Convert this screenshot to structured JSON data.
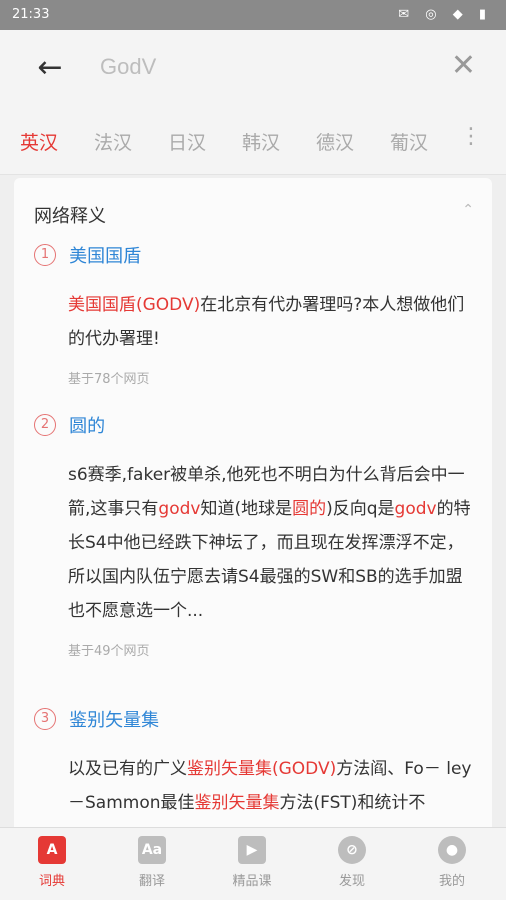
{
  "status": {
    "time": "21:33"
  },
  "search": {
    "query": "GodV"
  },
  "tabs": [
    "英汉",
    "法汉",
    "日汉",
    "韩汉",
    "德汉",
    "葡汉"
  ],
  "section": {
    "title": "网络释义"
  },
  "entries": [
    {
      "num": "1",
      "headword": "美国国盾",
      "example_parts": [
        {
          "t": "美国国盾",
          "h": true
        },
        {
          "t": "(GODV)",
          "h": true
        },
        {
          "t": "在北京有代办署理吗?本人想做他们的代办署理!",
          "h": false
        }
      ],
      "source": "基于78个网页"
    },
    {
      "num": "2",
      "headword": "圆的",
      "example_parts": [
        {
          "t": "s6赛季,faker被单杀,他死也不明白为什么背后会中一箭,这事只有",
          "h": false
        },
        {
          "t": "godv",
          "h": true
        },
        {
          "t": "知道(地球是",
          "h": false
        },
        {
          "t": "圆的",
          "h": true
        },
        {
          "t": ")反向q是",
          "h": false
        },
        {
          "t": "godv",
          "h": true
        },
        {
          "t": "的特长S4中他已经跌下神坛了，而且现在发挥漂浮不定，所以国内队伍宁愿去请S4最强的SW和SB的选手加盟也不愿意选一个...",
          "h": false
        }
      ],
      "source": "基于49个网页"
    },
    {
      "num": "3",
      "headword": "鉴别矢量集",
      "example_parts": [
        {
          "t": "以及已有的广义",
          "h": false
        },
        {
          "t": "鉴别矢量集",
          "h": true
        },
        {
          "t": "(GODV)",
          "h": true
        },
        {
          "t": "方法阎、Fo－ ley－Sammon最佳",
          "h": false
        },
        {
          "t": "鉴别矢量集",
          "h": true
        },
        {
          "t": "方法(FST)和统计不",
          "h": false
        }
      ],
      "source": ""
    }
  ],
  "nav": [
    {
      "label": "词典",
      "icon": "A"
    },
    {
      "label": "翻译",
      "icon": "Aa"
    },
    {
      "label": "精品课",
      "icon": "▶"
    },
    {
      "label": "发现",
      "icon": "⊘"
    },
    {
      "label": "我的",
      "icon": "●"
    }
  ],
  "colors": {
    "accent": "#e53935",
    "link": "#2f86d6"
  }
}
